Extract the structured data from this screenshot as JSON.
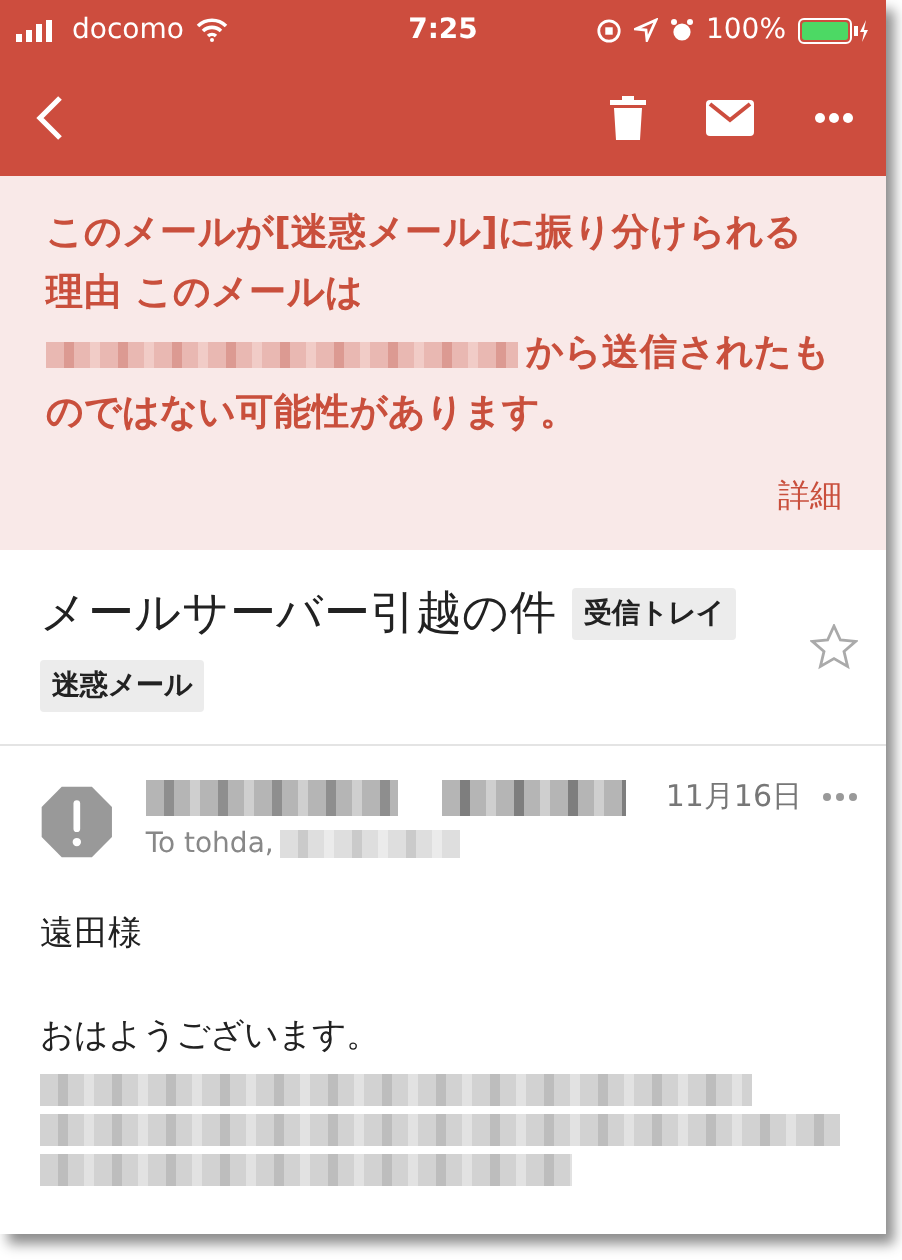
{
  "status_bar": {
    "carrier": "docomo",
    "time": "7:25",
    "battery": "100%"
  },
  "spam_notice": {
    "text_before": "このメールが[迷惑メール]に振り分けられる理由 このメールは",
    "text_after": [
      "から送信されたも",
      "のではない可能性があります。"
    ],
    "details_link": "詳細"
  },
  "message": {
    "subject": "メールサーバー引越の件",
    "labels": [
      "受信トレイ",
      "迷惑メール"
    ],
    "starred": false,
    "date": "11月16日",
    "to_prefix": "To tohda,",
    "greeting": "遠田様",
    "body_first_line": "おはようございます。"
  }
}
